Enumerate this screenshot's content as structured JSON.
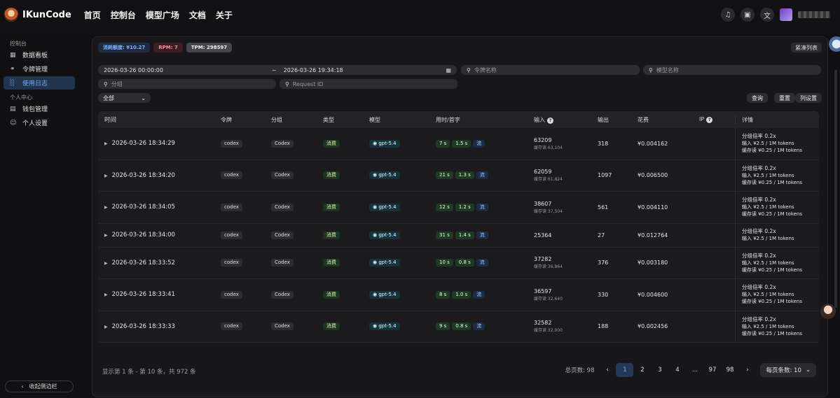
{
  "nav": {
    "brand": "IKunCode",
    "links": [
      "首页",
      "控制台",
      "模型广场",
      "文档",
      "关于"
    ]
  },
  "sidebar": {
    "group1": "控制台",
    "items1": [
      {
        "label": "数据看板",
        "icon": "dashboard-icon"
      },
      {
        "label": "令牌管理",
        "icon": "key-icon"
      },
      {
        "label": "使用日志",
        "icon": "chart-icon"
      }
    ],
    "group2": "个人中心",
    "items2": [
      {
        "label": "钱包管理",
        "icon": "wallet-icon"
      },
      {
        "label": "个人设置",
        "icon": "user-icon"
      }
    ],
    "collapse": "收起侧边栏"
  },
  "stats": {
    "quota": "消耗额度: ¥10.27",
    "rpm": "RPM: 7",
    "tpm": "TPM: 298597",
    "compact": "紧凑列表"
  },
  "filters": {
    "start": "2026-03-26 00:00:00",
    "sep": "~",
    "end": "2026-03-26 19:34:18",
    "token_ph": "令牌名称",
    "model_ph": "模型名称",
    "group_ph": "分组",
    "request_ph": "Request ID",
    "type_select": "全部",
    "query": "查询",
    "reset": "重置",
    "columns": "列设置"
  },
  "table": {
    "headers": [
      "时间",
      "令牌",
      "分组",
      "类型",
      "模型",
      "用时/首字",
      "输入",
      "输出",
      "花费",
      "IP",
      "详情"
    ],
    "rows": [
      {
        "time": "2026-03-26 18:34:29",
        "token": "codex",
        "group": "Codex",
        "type": "消费",
        "model": "gpt-5.4",
        "dur": "7 s",
        "first": "1.5 s",
        "stream": "流",
        "input": "63209",
        "cache": "缓存读 63,104",
        "output": "318",
        "cost": "¥0.004162",
        "d1": "分组倍率 0.2x",
        "d2": "输入 ¥2.5 / 1M tokens",
        "d3": "缓存读 ¥0.25 / 1M tokens"
      },
      {
        "time": "2026-03-26 18:34:20",
        "token": "codex",
        "group": "Codex",
        "type": "消费",
        "model": "gpt-5.4",
        "dur": "21 s",
        "first": "1.3 s",
        "stream": "流",
        "input": "62059",
        "cache": "缓存读 61,824",
        "output": "1097",
        "cost": "¥0.006500",
        "d1": "分组倍率 0.2x",
        "d2": "输入 ¥2.5 / 1M tokens",
        "d3": "缓存读 ¥0.25 / 1M tokens"
      },
      {
        "time": "2026-03-26 18:34:05",
        "token": "codex",
        "group": "Codex",
        "type": "消费",
        "model": "gpt-5.4",
        "dur": "12 s",
        "first": "1.2 s",
        "stream": "流",
        "input": "38607",
        "cache": "缓存读 37,504",
        "output": "561",
        "cost": "¥0.004110",
        "d1": "分组倍率 0.2x",
        "d2": "输入 ¥2.5 / 1M tokens",
        "d3": "缓存读 ¥0.25 / 1M tokens"
      },
      {
        "time": "2026-03-26 18:34:00",
        "token": "codex",
        "group": "Codex",
        "type": "消费",
        "model": "gpt-5.4",
        "dur": "31 s",
        "first": "1.4 s",
        "stream": "流",
        "input": "25364",
        "cache": "",
        "output": "27",
        "cost": "¥0.012764",
        "d1": "分组倍率 0.2x",
        "d2": "输入 ¥2.5 / 1M tokens",
        "d3": ""
      },
      {
        "time": "2026-03-26 18:33:52",
        "token": "codex",
        "group": "Codex",
        "type": "消费",
        "model": "gpt-5.4",
        "dur": "10 s",
        "first": "0.8 s",
        "stream": "流",
        "input": "37282",
        "cache": "缓存读 36,864",
        "output": "376",
        "cost": "¥0.003180",
        "d1": "分组倍率 0.2x",
        "d2": "输入 ¥2.5 / 1M tokens",
        "d3": "缓存读 ¥0.25 / 1M tokens"
      },
      {
        "time": "2026-03-26 18:33:41",
        "token": "codex",
        "group": "Codex",
        "type": "消费",
        "model": "gpt-5.4",
        "dur": "8 s",
        "first": "1.0 s",
        "stream": "流",
        "input": "36597",
        "cache": "缓存读 32,640",
        "output": "330",
        "cost": "¥0.004600",
        "d1": "分组倍率 0.2x",
        "d2": "输入 ¥2.5 / 1M tokens",
        "d3": "缓存读 ¥0.25 / 1M tokens"
      },
      {
        "time": "2026-03-26 18:33:33",
        "token": "codex",
        "group": "Codex",
        "type": "消费",
        "model": "gpt-5.4",
        "dur": "9 s",
        "first": "0.8 s",
        "stream": "流",
        "input": "32582",
        "cache": "缓存读 32,000",
        "output": "188",
        "cost": "¥0.002456",
        "d1": "分组倍率 0.2x",
        "d2": "输入 ¥2.5 / 1M tokens",
        "d3": "缓存读 ¥0.25 / 1M tokens"
      }
    ]
  },
  "footer": {
    "info": "显示第 1 条 - 第 10 条，共 972 条",
    "total_label": "总页数: 98",
    "pages": [
      "1",
      "2",
      "3",
      "4",
      "...",
      "97",
      "98"
    ],
    "per_page": "每页条数: 10"
  }
}
